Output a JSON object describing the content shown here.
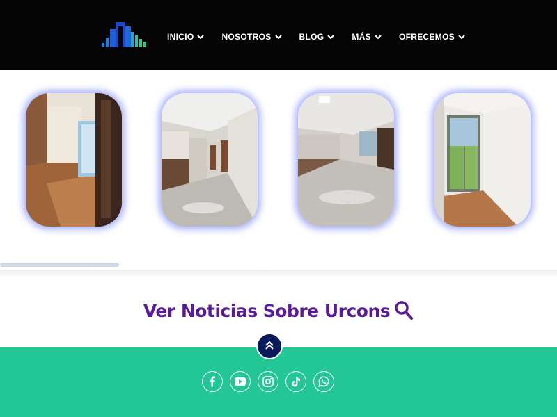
{
  "header": {
    "logo_icon": "building-logo-icon",
    "nav": [
      {
        "label": "INICIO",
        "icon": "chevron-down-icon"
      },
      {
        "label": "NOSOTROS",
        "icon": "chevron-down-icon"
      },
      {
        "label": "BLOG",
        "icon": "chevron-down-icon"
      },
      {
        "label": "MÁS",
        "icon": "chevron-down-icon"
      },
      {
        "label": "OFRECEMOS",
        "icon": "chevron-down-icon"
      }
    ]
  },
  "gallery": {
    "images": [
      {
        "subject": "room with wooden floor and window"
      },
      {
        "subject": "kitchen and hallway with tiled floor"
      },
      {
        "subject": "open kitchen and living area with tiled floor"
      },
      {
        "subject": "bedroom with wooden floor and glass door"
      }
    ],
    "scroll_progress": 0.21
  },
  "news": {
    "title": "Ver Noticias Sobre Urcons",
    "icon": "search-icon"
  },
  "footer": {
    "scroll_top_icon": "double-chevron-up-icon",
    "socials": [
      {
        "icon": "facebook-icon"
      },
      {
        "icon": "youtube-icon"
      },
      {
        "icon": "instagram-icon"
      },
      {
        "icon": "tiktok-icon"
      },
      {
        "icon": "whatsapp-icon"
      }
    ]
  },
  "colors": {
    "header_bg": "#050505",
    "accent_purple": "#5a1a9c",
    "footer_green": "#22c795",
    "scroll_button": "#0b1a5a",
    "photo_glow": "#5a6eff"
  }
}
